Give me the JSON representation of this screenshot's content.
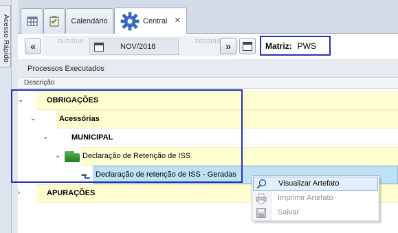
{
  "side": {
    "tab_label": "Acesso Rápido"
  },
  "tabs": [
    {
      "label": "",
      "icon": "grid-icon"
    },
    {
      "label": "",
      "icon": "checklist-icon"
    },
    {
      "label": "Calendário"
    },
    {
      "label": "Central",
      "icon": "gear-icon",
      "active": true,
      "close": "✕"
    }
  ],
  "toolbar": {
    "prev": "«",
    "next": "»",
    "prev_month": "OUT/2018",
    "current_month": "NOV/2018",
    "next_month": "DEZ/2018",
    "matriz_label": "Matriz:",
    "matriz_value": "PWS"
  },
  "tree": {
    "group_header": "Processos Executados",
    "column_header": "Descrição",
    "rows": [
      {
        "label": "OBRIGAÇÕES",
        "level": 0,
        "expanded": true
      },
      {
        "label": "Acessórias",
        "level": 1,
        "expanded": true
      },
      {
        "label": "MUNICIPAL",
        "level": 2,
        "expanded": true
      },
      {
        "label": "Declaração de Retenção de ISS",
        "level": 3,
        "expanded": true
      },
      {
        "label": "Declaração de retenção de ISS - Geradas",
        "level": 4,
        "selected": true
      },
      {
        "label": "APURAÇÕES",
        "level": 0,
        "expanded": false
      }
    ]
  },
  "context_menu": {
    "items": [
      {
        "label": "Visualizar Artefato",
        "enabled": true,
        "icon": "magnifier-icon"
      },
      {
        "label": "Imprimir Artefato",
        "enabled": false,
        "icon": "printer-icon"
      },
      {
        "label": "Salvar",
        "enabled": false,
        "icon": "floppy-icon"
      }
    ]
  },
  "colors": {
    "highlight_box": "#2430a8",
    "row_fill": "#fdfdd0",
    "selected_fill": "#bfe0f5"
  }
}
